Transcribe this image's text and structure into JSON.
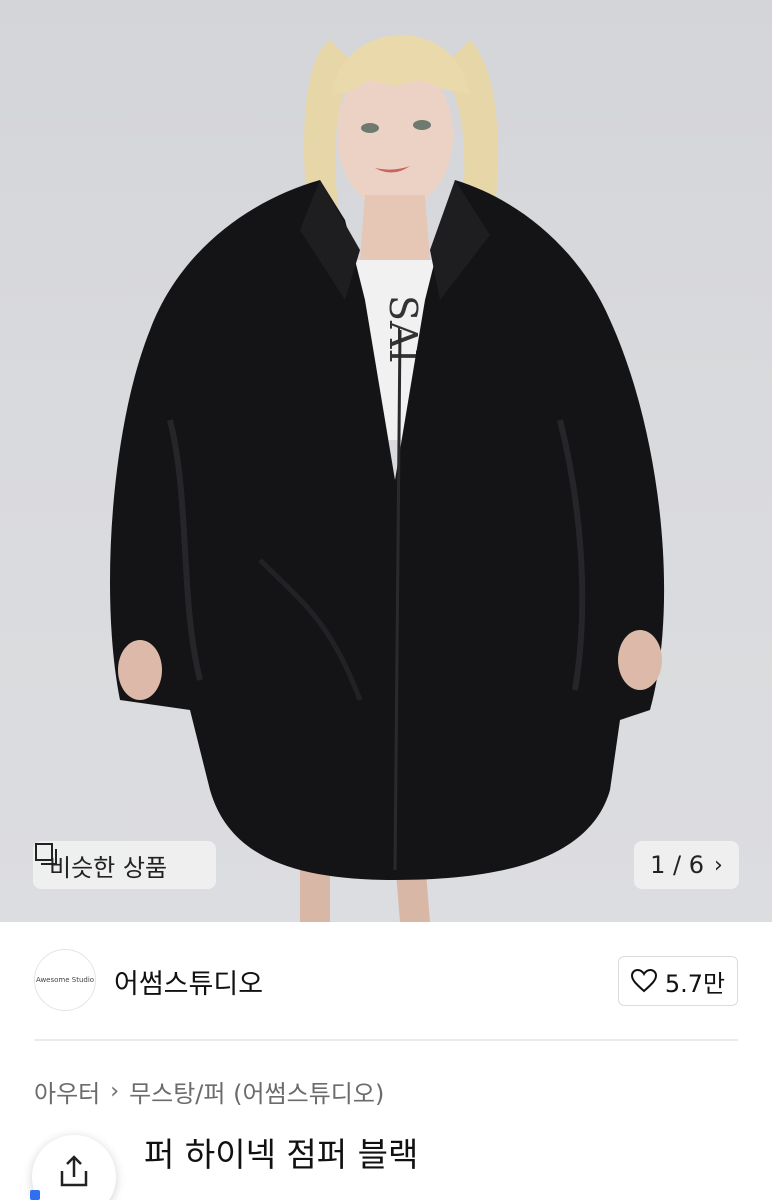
{
  "hero": {
    "image_desc": "product-photo",
    "similar_label": "비슷한 상품",
    "counter": "1 / 6"
  },
  "seller": {
    "avatar_text": "Awesome Studio",
    "name": "어썸스튜디오",
    "likes": "5.7만"
  },
  "product": {
    "breadcrumb": [
      "아우터",
      "무스탕/퍼 (어썸스튜디오)"
    ],
    "title": "퍼 하이넥 점퍼 블랙"
  },
  "colors": {
    "accent": "#2f6ff0",
    "jacket": "#111111",
    "background": "#d8d9dc"
  }
}
